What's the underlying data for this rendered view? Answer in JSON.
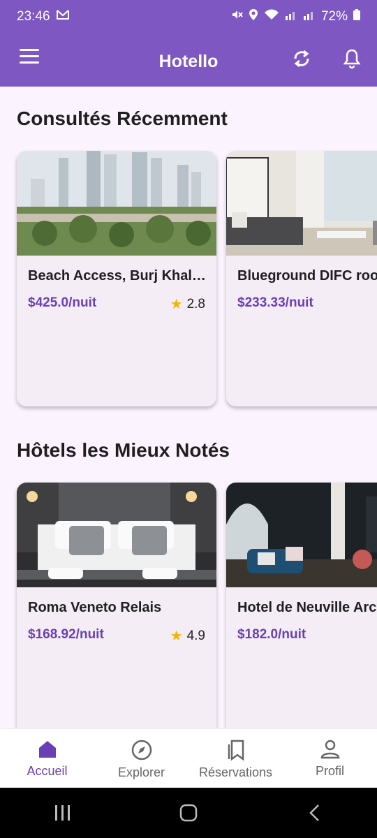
{
  "status": {
    "time": "23:46",
    "battery": "72%"
  },
  "app": {
    "title": "Hotello"
  },
  "sections": [
    {
      "title": "Consultés Récemment",
      "cards": [
        {
          "name": "Beach Access, Burj Khal…",
          "price": "$425.0/nuit",
          "rating": "2.8",
          "image": "city-skyline-image"
        },
        {
          "name": "Blueground DIFC roo",
          "price": "$233.33/nuit",
          "rating": "",
          "image": "living-room-image"
        }
      ]
    },
    {
      "title": "Hôtels les Mieux Notés",
      "cards": [
        {
          "name": "Roma Veneto Relais",
          "price": "$168.92/nuit",
          "rating": "4.9",
          "image": "hotel-bedroom-image"
        },
        {
          "name": "Hotel de Neuville Arc",
          "price": "$182.0/nuit",
          "rating": "",
          "image": "hotel-lounge-image"
        }
      ]
    }
  ],
  "nav": [
    {
      "label": "Accueil",
      "icon": "home-icon",
      "active": true
    },
    {
      "label": "Explorer",
      "icon": "compass-icon",
      "active": false
    },
    {
      "label": "Réservations",
      "icon": "bookmarks-icon",
      "active": false
    },
    {
      "label": "Profil",
      "icon": "person-icon",
      "active": false
    }
  ],
  "colors": {
    "primary": "#7e57c2",
    "price": "#6a3fb5",
    "star": "#f5b400",
    "background": "#fbf3fd"
  }
}
